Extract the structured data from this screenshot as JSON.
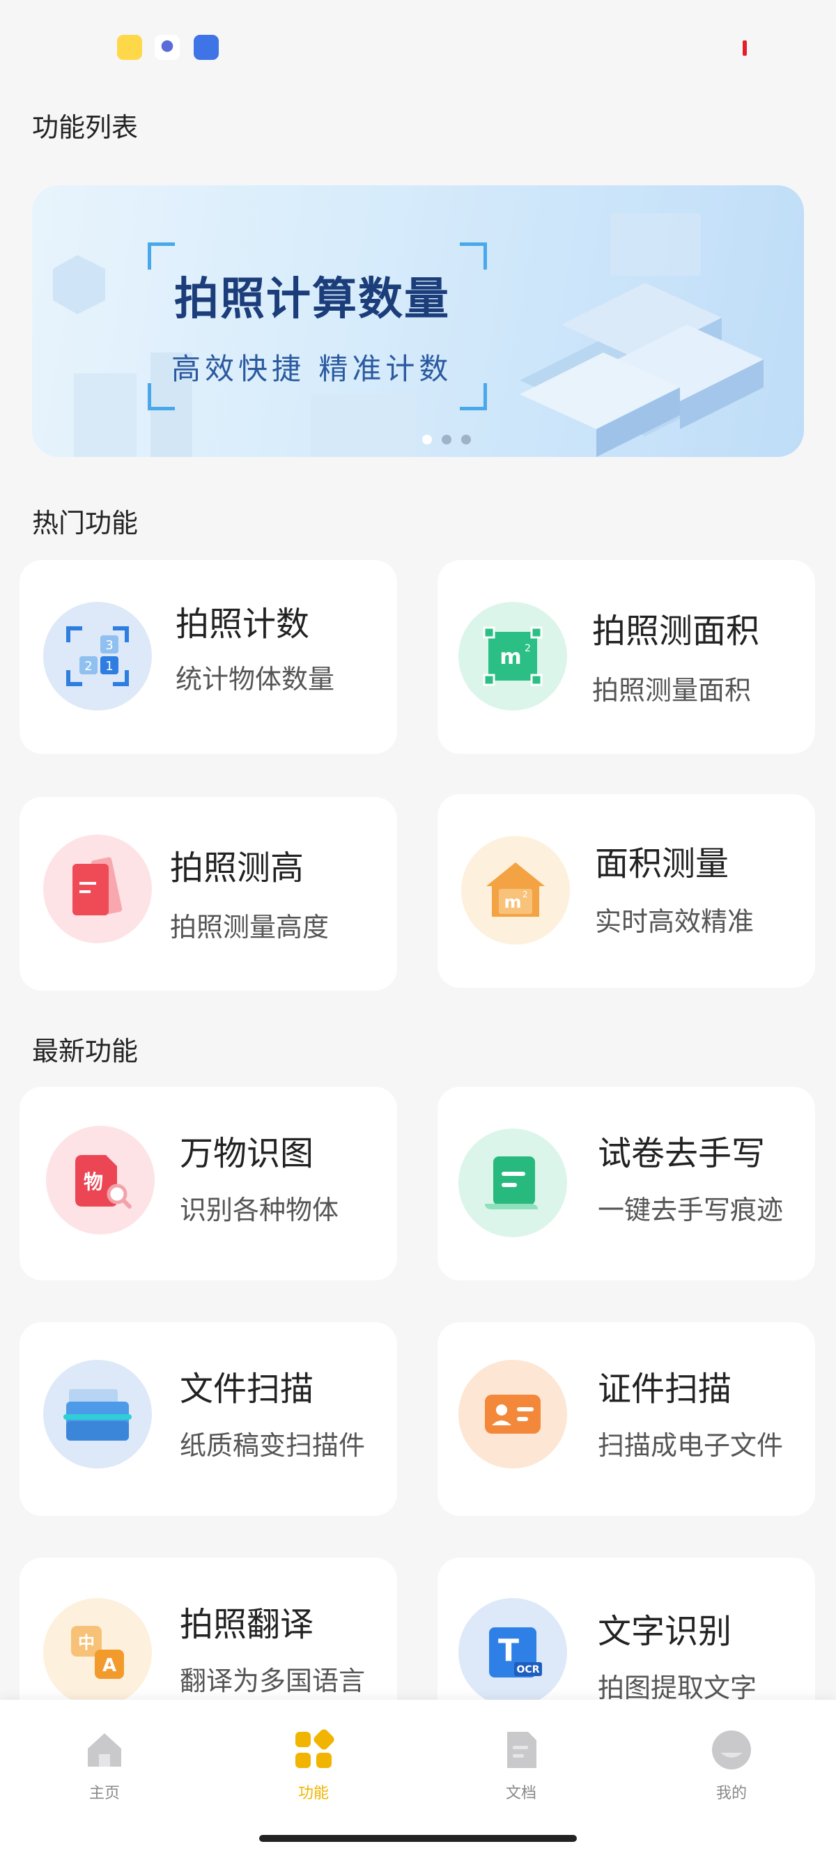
{
  "page": {
    "title": "功能列表"
  },
  "banner": {
    "title": "拍照计算数量",
    "subtitle": "高效快捷 精准计数",
    "page_count": 3,
    "active_index": 0
  },
  "sections": {
    "hot": "热门功能",
    "new": "最新功能"
  },
  "hot_features": [
    {
      "title": "拍照计数",
      "subtitle": "统计物体数量",
      "icon": "count-icon"
    },
    {
      "title": "拍照测面积",
      "subtitle": "拍照测量面积",
      "icon": "area-m2-icon"
    },
    {
      "title": "拍照测高",
      "subtitle": "拍照测量高度",
      "icon": "ruler-icon"
    },
    {
      "title": "面积测量",
      "subtitle": "实时高效精准",
      "icon": "house-m2-icon"
    }
  ],
  "new_features": [
    {
      "title": "万物识图",
      "subtitle": "识别各种物体",
      "icon": "object-search-icon"
    },
    {
      "title": "试卷去手写",
      "subtitle": "一键去手写痕迹",
      "icon": "scroll-icon"
    },
    {
      "title": "文件扫描",
      "subtitle": "纸质稿变扫描件",
      "icon": "folder-scan-icon"
    },
    {
      "title": "证件扫描",
      "subtitle": "扫描成电子文件",
      "icon": "id-card-icon"
    },
    {
      "title": "拍照翻译",
      "subtitle": "翻译为多国语言",
      "icon": "translate-icon"
    },
    {
      "title": "文字识别",
      "subtitle": "拍图提取文字",
      "icon": "ocr-icon"
    }
  ],
  "ocr_badge": "OCR",
  "tabbar": {
    "items": [
      {
        "label": "主页",
        "icon": "home-icon"
      },
      {
        "label": "功能",
        "icon": "grid-icon"
      },
      {
        "label": "文档",
        "icon": "document-icon"
      },
      {
        "label": "我的",
        "icon": "profile-icon"
      }
    ],
    "active": "功能",
    "active_color": "#f1b400"
  },
  "colors": {
    "background": "#f6f6f7",
    "banner_title": "#1b3d7a",
    "accent_yellow": "#f1b400"
  }
}
